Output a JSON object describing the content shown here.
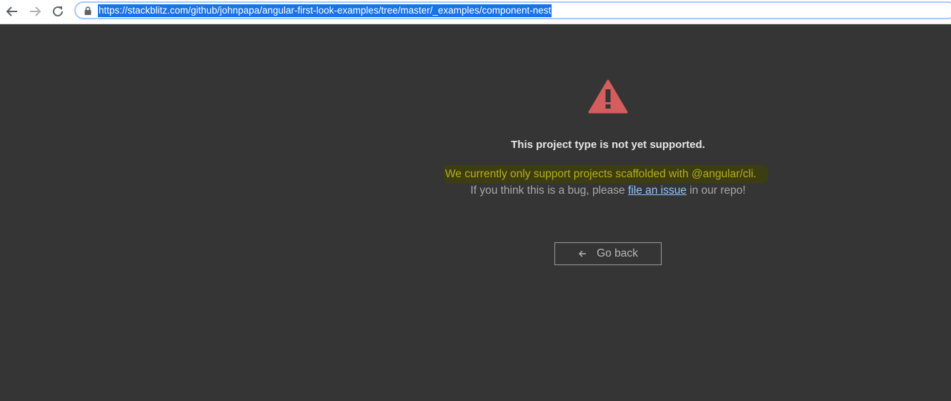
{
  "browser": {
    "url": "https://stackblitz.com/github/johnpapa/angular-first-look-examples/tree/master/_examples/component-nest",
    "icons": [
      "back-arrow-icon",
      "forward-arrow-icon",
      "reload-icon",
      "lock-icon"
    ]
  },
  "error": {
    "icon": "warning-triangle-icon",
    "icon_color": "#d45d5d",
    "title": "This project type is not yet supported.",
    "support_message": "We currently only support projects scaffolded with @angular/cli.",
    "bug_prefix": "If you think this is a bug, please",
    "bug_link": "file an issue",
    "bug_suffix": "in our repo!",
    "go_back_label": "Go back"
  },
  "colors": {
    "background": "#353535",
    "highlight": "#3d3d12",
    "highlight_text": "#b5ae20",
    "link": "#8fc6ff",
    "url_selection": "#1a73e8"
  }
}
